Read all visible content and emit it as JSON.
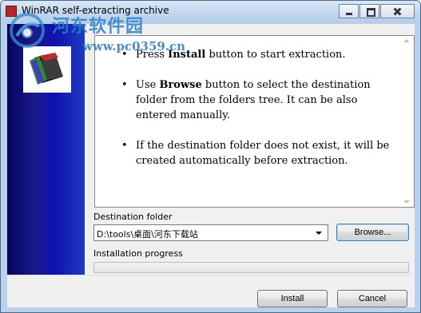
{
  "window": {
    "title": "WinRAR self-extracting archive"
  },
  "watermark": {
    "site_name": "河东软件园",
    "url": "www.pc0359.cn"
  },
  "info": {
    "bullets": [
      {
        "before": "Press ",
        "bold": "Install",
        "after": " button to start extraction."
      },
      {
        "before": "Use ",
        "bold": "Browse",
        "after": " button to select the destination folder from the folders tree. It can be also entered manually."
      },
      {
        "before": "If the destination folder does not exist, it will be created automatically before extraction.",
        "bold": "",
        "after": ""
      }
    ]
  },
  "destination": {
    "label": "Destination folder",
    "value": "D:\\tools\\桌面\\河东下载站",
    "browse_label": "Browse..."
  },
  "progress": {
    "label": "Installation progress",
    "value": 0
  },
  "buttons": {
    "install_label": "Install",
    "cancel_label": "Cancel"
  },
  "icons": {
    "title_icon": "winrar-icon",
    "logo": "winrar-sfx-logo-icon"
  }
}
